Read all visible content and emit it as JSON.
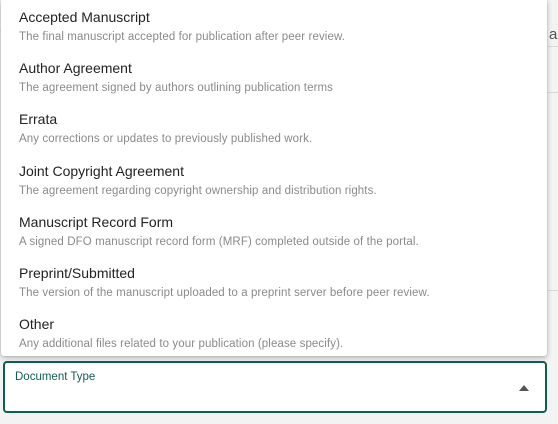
{
  "background": {
    "fragment_text": "a"
  },
  "dropdown": {
    "options": [
      {
        "title": "Accepted Manuscript",
        "description": "The final manuscript accepted for publication after peer review."
      },
      {
        "title": "Author Agreement",
        "description": "The agreement signed by authors outlining publication terms"
      },
      {
        "title": "Errata",
        "description": "Any corrections or updates to previously published work."
      },
      {
        "title": "Joint Copyright Agreement",
        "description": "The agreement regarding copyright ownership and distribution rights."
      },
      {
        "title": "Manuscript Record Form",
        "description": "A signed DFO manuscript record form (MRF) completed outside of the portal."
      },
      {
        "title": "Preprint/Submitted",
        "description": "The version of the manuscript uploaded to a preprint server before peer review."
      },
      {
        "title": "Other",
        "description": "Any additional files related to your publication (please specify)."
      }
    ]
  },
  "field": {
    "label": "Document Type",
    "value": "",
    "caret_icon": "caret-up-icon",
    "accent_color": "#0f5e52"
  }
}
